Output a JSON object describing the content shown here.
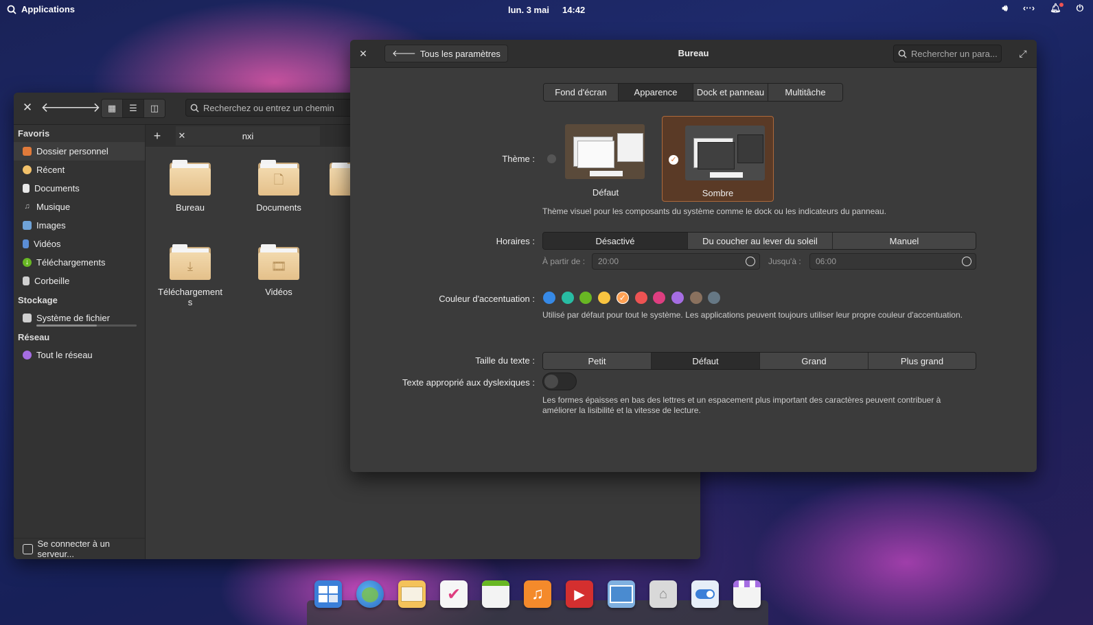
{
  "topbar": {
    "applications_label": "Applications",
    "date": "lun. 3 mai",
    "time": "14:42",
    "indicators": [
      "volume-icon",
      "network-icon",
      "notifications-icon",
      "power-icon"
    ]
  },
  "files": {
    "search_placeholder": "Recherchez ou entrez un chemin",
    "tab_label": "nxi",
    "sidebar": {
      "favorites_header": "Favoris",
      "favorites": [
        {
          "label": "Dossier personnel",
          "icon": "home-icon"
        },
        {
          "label": "Récent",
          "icon": "recent-icon"
        },
        {
          "label": "Documents",
          "icon": "documents-icon"
        },
        {
          "label": "Musique",
          "icon": "music-icon"
        },
        {
          "label": "Images",
          "icon": "images-icon"
        },
        {
          "label": "Vidéos",
          "icon": "videos-icon"
        },
        {
          "label": "Téléchargements",
          "icon": "downloads-icon"
        },
        {
          "label": "Corbeille",
          "icon": "trash-icon"
        }
      ],
      "storage_header": "Stockage",
      "storage_item": "Système de fichier",
      "network_header": "Réseau",
      "network_item": "Tout le réseau",
      "connect_server": "Se connecter à un serveur..."
    },
    "folders": [
      {
        "label": "Bureau",
        "glyph": ""
      },
      {
        "label": "Documents",
        "glyph": "🗋"
      },
      {
        "label": "Téléchargements",
        "glyph": "⤓"
      },
      {
        "label": "Vidéos",
        "glyph": "🎞"
      }
    ]
  },
  "settings": {
    "back_label": "Tous les paramètres",
    "title": "Bureau",
    "search_placeholder": "Rechercher un para...",
    "tabs": [
      "Fond d'écran",
      "Apparence",
      "Dock et panneau",
      "Multitâche"
    ],
    "selected_tab": "Apparence",
    "theme": {
      "label": "Thème :",
      "options": [
        "Défaut",
        "Sombre"
      ],
      "selected": "Sombre",
      "description": "Thème visuel pour les composants du système comme le dock ou les indicateurs du panneau."
    },
    "schedule": {
      "label": "Horaires :",
      "options": [
        "Désactivé",
        "Du coucher au lever du soleil",
        "Manuel"
      ],
      "selected": "Désactivé",
      "from_label": "À partir de :",
      "from_value": "20:00",
      "to_label": "Jusqu'à :",
      "to_value": "06:00"
    },
    "accent": {
      "label": "Couleur d'accentuation :",
      "colors": [
        "#3689e6",
        "#28bca3",
        "#68b723",
        "#f9c440",
        "#ffa154",
        "#ed5353",
        "#de3e80",
        "#a56de2",
        "#8a715e",
        "#667885"
      ],
      "selected_index": 4,
      "description": "Utilisé par défaut pour tout le système. Les applications peuvent toujours utiliser leur propre couleur d'accentuation."
    },
    "text_size": {
      "label": "Taille du texte :",
      "options": [
        "Petit",
        "Défaut",
        "Grand",
        "Plus grand"
      ],
      "selected": "Défaut"
    },
    "dyslexia": {
      "label": "Texte approprié aux dyslexiques :",
      "enabled": false,
      "description_line1": "Les formes épaisses en bas des lettres et un espacement plus important des caractères peuvent contribuer à",
      "description_line2": "améliorer la lisibilité et la vitesse de lecture."
    },
    "accent_active": "#e07a3a"
  },
  "dock": [
    "multitasking-view-icon",
    "web-browser-icon",
    "mail-icon",
    "tasks-icon",
    "calendar-icon",
    "music-icon",
    "videos-icon",
    "photos-icon",
    "files-icon",
    "settings-icon",
    "appcenter-icon"
  ]
}
